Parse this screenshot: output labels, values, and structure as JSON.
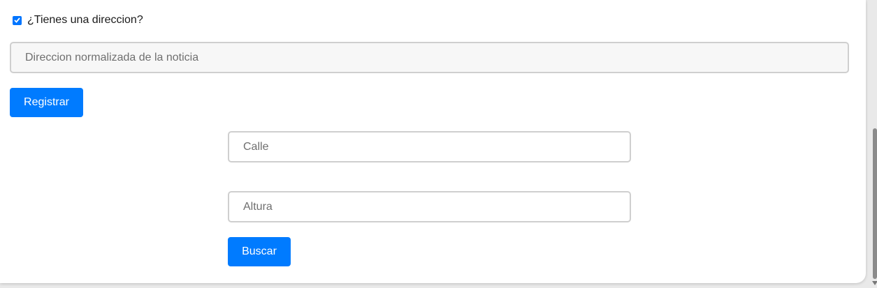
{
  "address_toggle": {
    "label": "¿Tienes una direccion?",
    "checked": true
  },
  "normalized_address": {
    "placeholder": "Direccion normalizada de la noticia"
  },
  "register_button": {
    "label": "Registrar"
  },
  "search_form": {
    "street": {
      "placeholder": "Calle"
    },
    "number": {
      "placeholder": "Altura"
    },
    "search_button": {
      "label": "Buscar"
    }
  },
  "colors": {
    "primary_button": "#007bff",
    "checkbox": "#0075ff",
    "input_border": "#cfcfcf",
    "placeholder_text": "#6f6f6f"
  },
  "icons": {
    "checkbox_mark": "checkmark-icon",
    "scroll_down": "chevron-down-icon"
  }
}
